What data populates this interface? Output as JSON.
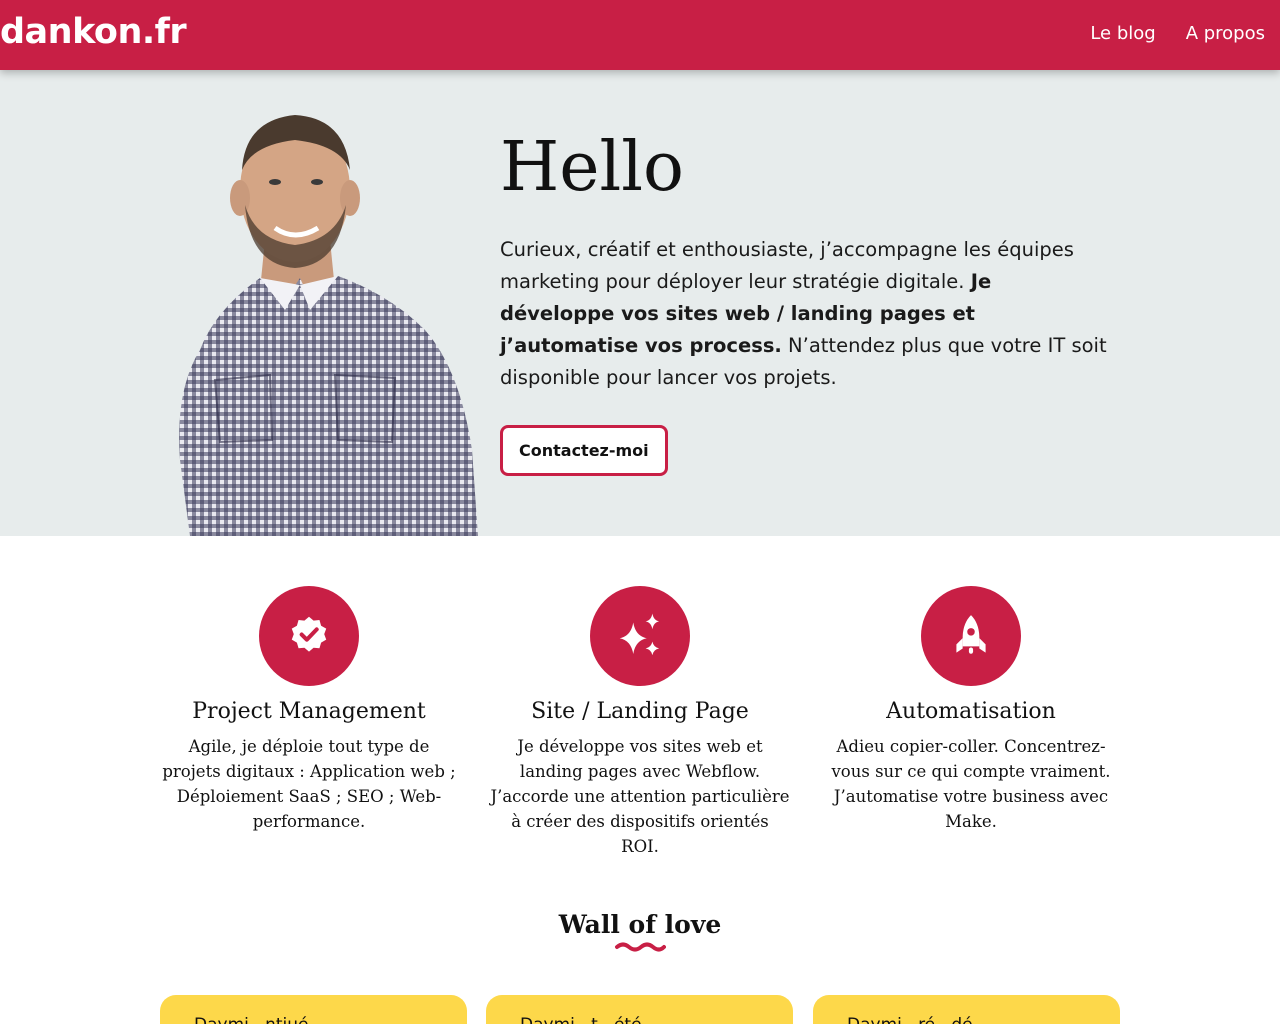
{
  "header": {
    "logo": "dankon.fr",
    "nav": [
      {
        "label": "Le blog"
      },
      {
        "label": "A propos"
      }
    ],
    "background_color": "#c81f45"
  },
  "hero": {
    "title": "Hello",
    "intro": "Curieux, créatif et enthousiaste, j’accompagne les équipes marketing pour déployer leur stratégie digitale. ",
    "highlight": "Je développe vos sites web / landing pages et j’automatise vos process.",
    "outro": " N’attendez plus que votre IT soit disponible pour lancer vos projets.",
    "cta_label": "Contactez-moi",
    "background_color": "#e7ecec"
  },
  "features": [
    {
      "icon": "badge-check-icon",
      "title": "Project Management",
      "text": "Agile, je déploie tout type de projets digitaux : Application web ; Déploiement SaaS ; SEO ; Web-performance."
    },
    {
      "icon": "sparkles-icon",
      "title": "Site / Landing Page",
      "text": "Je développe vos sites web et landing pages avec Webflow. J’accorde une attention particulière à créer des dispositifs orientés ROI."
    },
    {
      "icon": "rocket-icon",
      "title": "Automatisation",
      "text": "Adieu copier-coller. Concentrez-vous sur ce qui compte vraiment. J’automatise votre business avec Make."
    }
  ],
  "wall_of_love": {
    "title": "Wall of love",
    "cards": [
      {
        "text": "Daymi...ntiué"
      },
      {
        "text": "Daymi...t...été"
      },
      {
        "text": "Daymi...ré...dé..."
      }
    ],
    "card_color": "#fdd84a"
  },
  "accent_color": "#c81f45"
}
